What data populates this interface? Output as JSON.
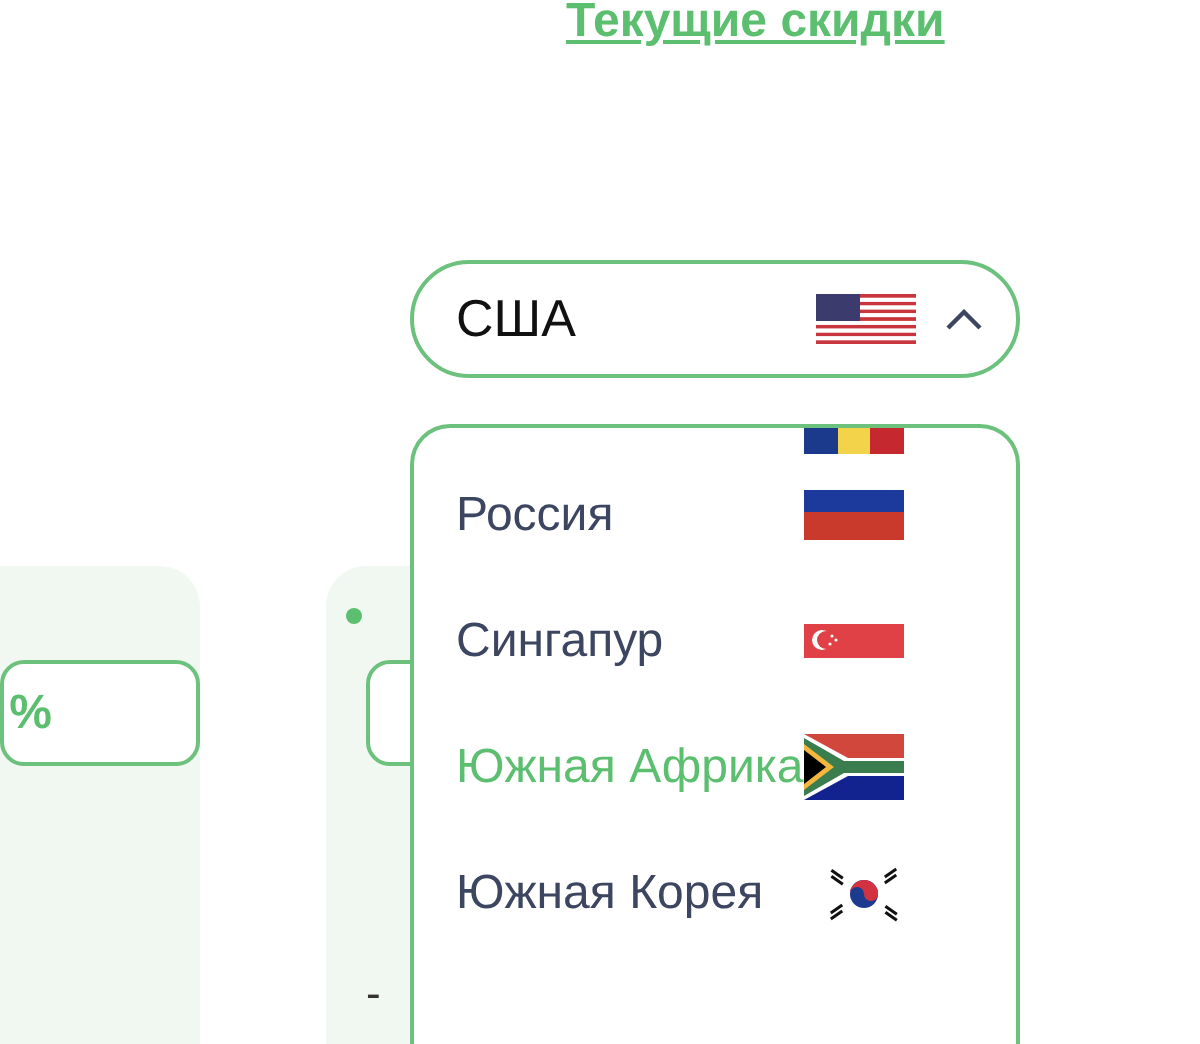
{
  "link": "Текущие скидки",
  "country_select": {
    "value": "США",
    "expanded": true
  },
  "country_options": [
    {
      "label": "Россия",
      "selected": false
    },
    {
      "label": "Сингапур",
      "selected": false
    },
    {
      "label": "Южная Африка",
      "selected": true
    },
    {
      "label": "Южная Корея",
      "selected": false
    }
  ],
  "cards": [
    {
      "field_value": "%"
    },
    {
      "note": "-"
    }
  ]
}
